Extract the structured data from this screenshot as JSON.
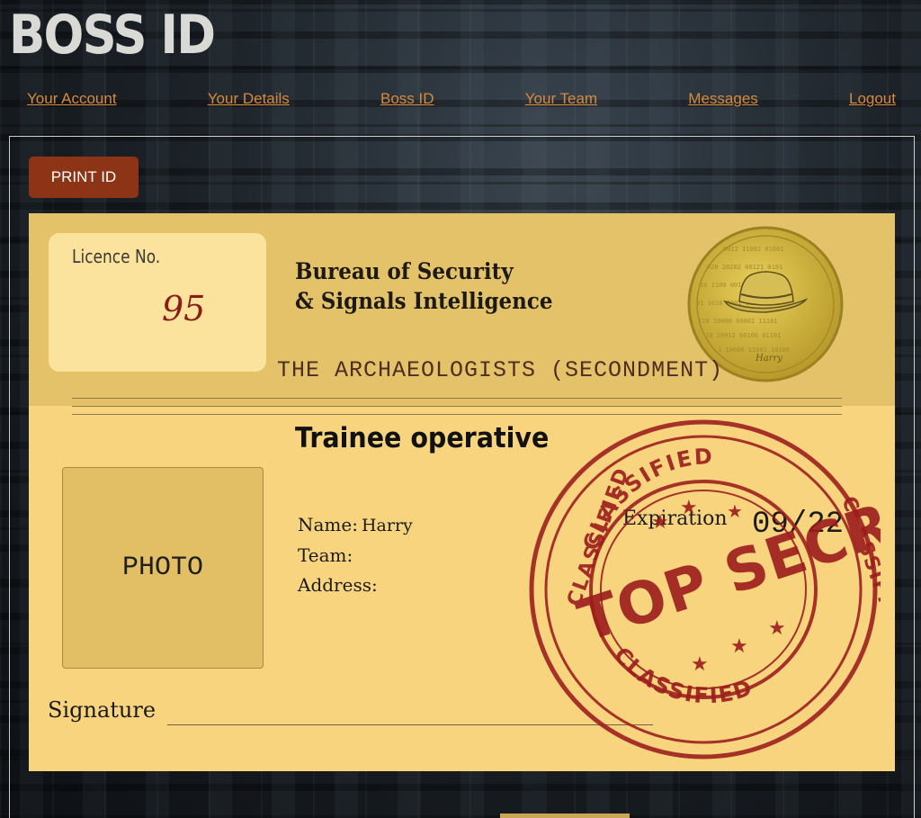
{
  "app": {
    "title": "BOSS ID"
  },
  "nav": {
    "items": [
      "Your Account",
      "Your Details",
      "Boss ID",
      "Your Team",
      "Messages",
      "Logout"
    ]
  },
  "actions": {
    "print_label": "PRINT ID"
  },
  "card": {
    "licence_label": "Licence No.",
    "licence_number": "95",
    "bureau_line1": "Bureau of Security",
    "bureau_line2": "& Signals Intelligence",
    "unit": "THE ARCHAEOLOGISTS (SECONDMENT)",
    "role": "Trainee operative",
    "photo_placeholder": "PHOTO",
    "name_label": "Name:",
    "name_value": "Harry",
    "team_label": "Team:",
    "address_label": "Address:",
    "expiry_label": "Expiration",
    "expiry_value": "09/22",
    "signature_label": "Signature",
    "seal_signature": "Harry",
    "stamp_top": "CLASSIFIED",
    "stamp_main": "TOP SECRET",
    "stamp_left": "CLASSIFIED",
    "stamp_right": "CLASSIFIED",
    "stamp_bottom": "CLASSIFIED"
  },
  "colors": {
    "accent_link": "#d8893b",
    "button_bg": "#8d3417",
    "card_bg": "#f8d47f",
    "card_header_bg": "#e3c26a",
    "stamp_red": "#9b1c1c"
  },
  "icons": {
    "seal": "fedora-hat-seal-icon",
    "stamp": "top-secret-stamp-icon"
  }
}
